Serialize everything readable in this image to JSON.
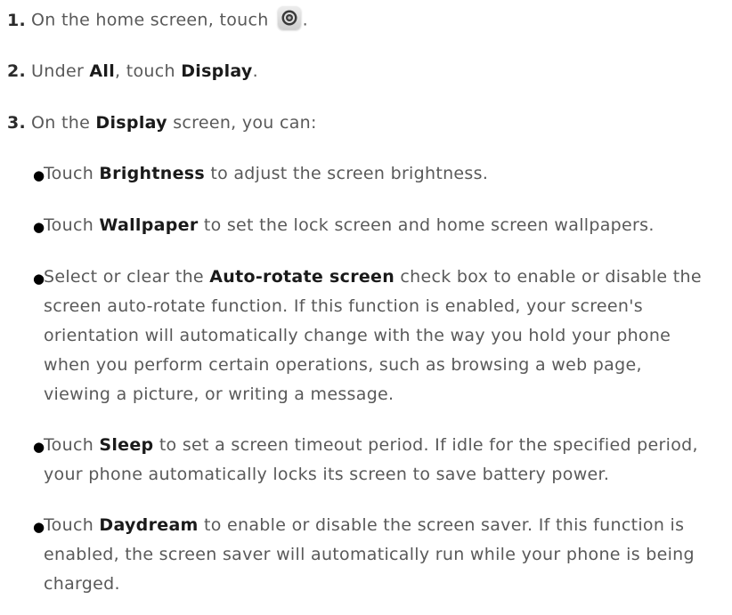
{
  "steps": [
    {
      "num": "1.",
      "text_a": "On the home screen, touch",
      "text_b": "."
    },
    {
      "num": "2.",
      "text_a": "Under",
      "kw1": "All",
      "text_b": ", touch",
      "kw2": "Display",
      "text_c": "."
    },
    {
      "num": "3.",
      "text_a": "On the",
      "kw1": "Display",
      "text_b": "screen, you can:"
    }
  ],
  "icons": {
    "settings": "settings-gear-icon"
  },
  "bullets": [
    {
      "pre": "Touch",
      "kw": "Brightness",
      "lines": [
        "to adjust the screen brightness."
      ]
    },
    {
      "pre": "Touch",
      "kw": "Wallpaper",
      "lines": [
        "to set the lock screen and home screen wallpapers."
      ]
    },
    {
      "pre": "Select or clear the",
      "kw": "Auto-rotate screen",
      "lines": [
        "check box to enable or disable the",
        "screen auto-rotate function. If this function is enabled, your screen's",
        "orientation will automatically change with the way you hold your phone",
        "when you perform certain operations, such as browsing a web page,",
        "viewing a picture, or writing a message."
      ]
    },
    {
      "pre": "Touch",
      "kw": "Sleep",
      "lines": [
        "to set a screen timeout period. If idle for the specified period,",
        "your phone automatically locks its screen to save battery power."
      ]
    },
    {
      "pre": "Touch",
      "kw": "Daydream",
      "lines": [
        "to enable or disable the screen saver. If this function is",
        "enabled, the screen saver will automatically run while your phone is being",
        "charged."
      ]
    }
  ]
}
